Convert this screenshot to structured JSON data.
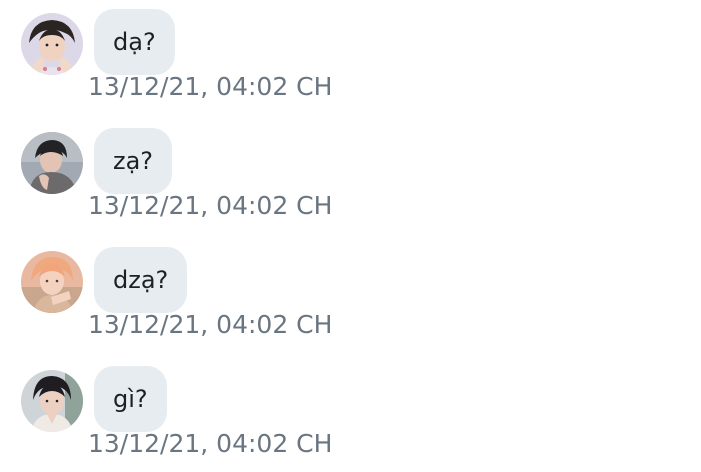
{
  "messages": [
    {
      "text": "dạ?",
      "time": "13/12/21, 04:02 CH",
      "avatar_icon": "person-photo-avatar",
      "avatar_bg": "#d9d4e6"
    },
    {
      "text": "zạ?",
      "time": "13/12/21, 04:02 CH",
      "avatar_icon": "person-photo-avatar",
      "avatar_bg": "#9aa1ab"
    },
    {
      "text": "dzạ?",
      "time": "13/12/21, 04:02 CH",
      "avatar_icon": "person-photo-avatar",
      "avatar_bg": "#e8b39a"
    },
    {
      "text": "gì?",
      "time": "13/12/21, 04:02 CH",
      "avatar_icon": "person-photo-avatar",
      "avatar_bg": "#c9cfd3"
    }
  ],
  "colors": {
    "bubble_bg": "#e7ecf1",
    "message_text": "#1c2126",
    "timestamp_text": "#6a7582",
    "background": "#ffffff"
  }
}
